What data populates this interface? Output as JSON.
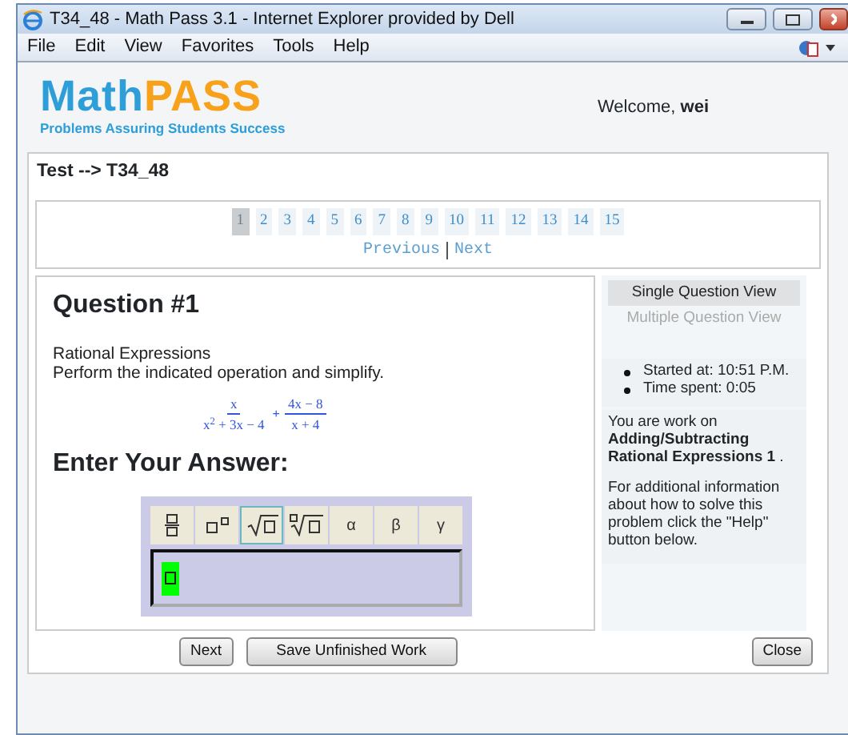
{
  "window": {
    "title": "T34_48 - Math Pass 3.1 - Internet Explorer provided by Dell"
  },
  "menu": [
    "File",
    "Edit",
    "View",
    "Favorites",
    "Tools",
    "Help"
  ],
  "logo": {
    "word_1": "Math",
    "word_2": "PASS",
    "tagline": "Problems Assuring Students Success"
  },
  "welcome": "Welcome, **wei**",
  "breadcrumb": "Test --> T34_48",
  "pages": [
    {
      "label": "1",
      "selected": true
    },
    {
      "label": "2",
      "selected": false
    },
    {
      "label": "3",
      "selected": false
    },
    {
      "label": "4",
      "selected": false
    },
    {
      "label": "5",
      "selected": false
    },
    {
      "label": "6",
      "selected": false
    },
    {
      "label": "7",
      "selected": false
    },
    {
      "label": "8",
      "selected": false
    },
    {
      "label": "9",
      "selected": false
    },
    {
      "label": "10",
      "selected": false
    },
    {
      "label": "11",
      "selected": false
    },
    {
      "label": "12",
      "selected": false
    },
    {
      "label": "13",
      "selected": false
    },
    {
      "label": "14",
      "selected": false
    },
    {
      "label": "15",
      "selected": false
    }
  ],
  "pager_links": [
    "Previous",
    "Next"
  ],
  "question": {
    "title": "Question #1",
    "topic": "Rational Expressions",
    "instruction": "Perform the indicated operation and simplify.",
    "expression": {
      "fraction_1": {
        "numerator": "x",
        "denominator": "x$^{2}$ + 3x − 4"
      },
      "operator": "+",
      "fraction_2": {
        "numerator": "4x − 8",
        "denominator": "x + 4"
      }
    },
    "answer_title": "Enter Your Answer:"
  },
  "toolbar": [
    {
      "kind": "fraction",
      "selected": false
    },
    {
      "kind": "power",
      "selected": false
    },
    {
      "kind": "sqrt",
      "selected": true
    },
    {
      "kind": "root",
      "selected": false
    },
    {
      "kind": "symbol",
      "label": "α",
      "selected": false
    },
    {
      "kind": "symbol",
      "label": "β",
      "selected": false
    },
    {
      "kind": "symbol",
      "label": "γ",
      "selected": false
    }
  ],
  "sidebar": {
    "views": [
      {
        "label": "Single Question View",
        "selected": true
      },
      {
        "label": "Multiple Question View",
        "selected": false
      }
    ],
    "stats": [
      "Started at: 10:51 P.M.",
      "Time spent: 0:05"
    ],
    "working_on": "You are work on **Adding/Subtracting Rational Expressions 1** .",
    "help_text": "For additional information about how to solve this problem click the \"Help\" button below."
  },
  "buttons": {
    "next": "Next",
    "save": "Save Unfinished Work",
    "close": "Close"
  }
}
